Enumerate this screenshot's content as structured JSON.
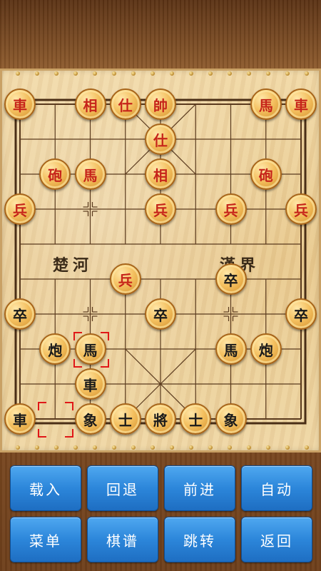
{
  "board": {
    "river_left": "楚河",
    "river_right": "漢界"
  },
  "colors": {
    "red": "#c6241a",
    "black": "#1a1a1a",
    "marker": "#e01818"
  },
  "pieces": [
    {
      "label": "車",
      "side": "red",
      "col": 0,
      "row": 0
    },
    {
      "label": "相",
      "side": "red",
      "col": 2,
      "row": 0
    },
    {
      "label": "仕",
      "side": "red",
      "col": 3,
      "row": 0
    },
    {
      "label": "帥",
      "side": "red",
      "col": 4,
      "row": 0
    },
    {
      "label": "馬",
      "side": "red",
      "col": 7,
      "row": 0
    },
    {
      "label": "車",
      "side": "red",
      "col": 8,
      "row": 0
    },
    {
      "label": "仕",
      "side": "red",
      "col": 4,
      "row": 1
    },
    {
      "label": "砲",
      "side": "red",
      "col": 1,
      "row": 2
    },
    {
      "label": "馬",
      "side": "red",
      "col": 2,
      "row": 2
    },
    {
      "label": "相",
      "side": "red",
      "col": 4,
      "row": 2
    },
    {
      "label": "砲",
      "side": "red",
      "col": 7,
      "row": 2
    },
    {
      "label": "兵",
      "side": "red",
      "col": 0,
      "row": 3
    },
    {
      "label": "兵",
      "side": "red",
      "col": 4,
      "row": 3
    },
    {
      "label": "兵",
      "side": "red",
      "col": 6,
      "row": 3
    },
    {
      "label": "兵",
      "side": "red",
      "col": 8,
      "row": 3
    },
    {
      "label": "兵",
      "side": "red",
      "col": 3,
      "row": 5
    },
    {
      "label": "卒",
      "side": "black",
      "col": 6,
      "row": 5
    },
    {
      "label": "卒",
      "side": "black",
      "col": 0,
      "row": 6
    },
    {
      "label": "卒",
      "side": "black",
      "col": 4,
      "row": 6
    },
    {
      "label": "卒",
      "side": "black",
      "col": 8,
      "row": 6
    },
    {
      "label": "炮",
      "side": "black",
      "col": 1,
      "row": 7
    },
    {
      "label": "馬",
      "side": "black",
      "col": 2,
      "row": 7
    },
    {
      "label": "馬",
      "side": "black",
      "col": 6,
      "row": 7
    },
    {
      "label": "炮",
      "side": "black",
      "col": 7,
      "row": 7
    },
    {
      "label": "車",
      "side": "black",
      "col": 2,
      "row": 8
    },
    {
      "label": "車",
      "side": "black",
      "col": 0,
      "row": 9
    },
    {
      "label": "象",
      "side": "black",
      "col": 2,
      "row": 9
    },
    {
      "label": "士",
      "side": "black",
      "col": 3,
      "row": 9
    },
    {
      "label": "將",
      "side": "black",
      "col": 4,
      "row": 9
    },
    {
      "label": "士",
      "side": "black",
      "col": 5,
      "row": 9
    },
    {
      "label": "象",
      "side": "black",
      "col": 6,
      "row": 9
    }
  ],
  "last_move": {
    "from": {
      "col": 1,
      "row": 9
    },
    "to": {
      "col": 2,
      "row": 7
    }
  },
  "buttons": [
    {
      "label": "载入",
      "name": "load-button"
    },
    {
      "label": "回退",
      "name": "undo-button"
    },
    {
      "label": "前进",
      "name": "forward-button"
    },
    {
      "label": "自动",
      "name": "auto-button"
    },
    {
      "label": "菜单",
      "name": "menu-button"
    },
    {
      "label": "棋谱",
      "name": "record-button"
    },
    {
      "label": "跳转",
      "name": "jump-button"
    },
    {
      "label": "返回",
      "name": "back-button"
    }
  ]
}
